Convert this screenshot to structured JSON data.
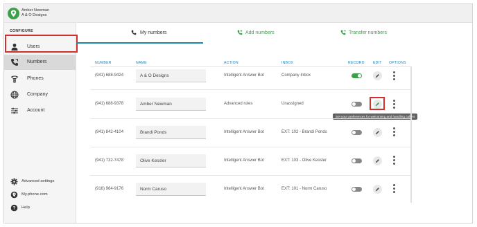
{
  "account": {
    "line1": "Amber Newman",
    "line2": "A & O Designs"
  },
  "sidebar": {
    "section_label": "CONFIGURE",
    "items": [
      {
        "label": "Users",
        "icon": "person-icon",
        "active": false
      },
      {
        "label": "Numbers",
        "icon": "phone-icon",
        "active": true
      },
      {
        "label": "Phones",
        "icon": "desk-phone-icon",
        "active": false
      },
      {
        "label": "Company",
        "icon": "globe-icon",
        "active": false
      },
      {
        "label": "Account",
        "icon": "sliders-icon",
        "active": false
      }
    ],
    "bottom": [
      {
        "label": "Advanced settings",
        "icon": "gear-icon"
      },
      {
        "label": "My.phone.com",
        "icon": "location-pin-icon"
      },
      {
        "label": "Help",
        "icon": "help-icon"
      }
    ]
  },
  "tabs": [
    {
      "label": "My numbers",
      "icon": "phone-icon",
      "active": true
    },
    {
      "label": "Add numbers",
      "icon": "phone-add-icon",
      "active": false
    },
    {
      "label": "Transfer numbers",
      "icon": "phone-transfer-icon",
      "active": false
    }
  ],
  "columns": {
    "number": "NUMBER",
    "name": "NAME",
    "action": "ACTION",
    "inbox": "INBOX",
    "record": "RECORD",
    "edit": "EDIT",
    "options": "OPTIONS"
  },
  "rows": [
    {
      "number": "(941) 688-9424",
      "name": "A & O Designs",
      "action": "Intelligent Answer Bot",
      "inbox": "Company Inbox",
      "record": true
    },
    {
      "number": "(941) 688-9378",
      "name": "Amber Newman",
      "action": "Advanced rules",
      "inbox": "Unassigned",
      "record": false
    },
    {
      "number": "(941) 842-4104",
      "name": "Brandi Ponds",
      "action": "Intelligent Answer Bot",
      "inbox": "EXT: 102 - Brandi Ponds",
      "record": false
    },
    {
      "number": "(941) 732-7478",
      "name": "Olive Kessler",
      "action": "Intelligent Answer Bot",
      "inbox": "EXT: 103 - Olive Kessler",
      "record": false
    },
    {
      "number": "(916) 964-9176",
      "name": "Norm Caruso",
      "action": "Intelligent Answer Bot",
      "inbox": "EXT: 101 - Norm Caruso",
      "record": false
    }
  ],
  "tooltip": "Set your preferences for welcoming and handling callers",
  "colors": {
    "accent_green": "#3aa14a",
    "header_blue": "#2980b9",
    "highlight_red": "#d0312d",
    "tab_underline": "#1e88a8"
  }
}
